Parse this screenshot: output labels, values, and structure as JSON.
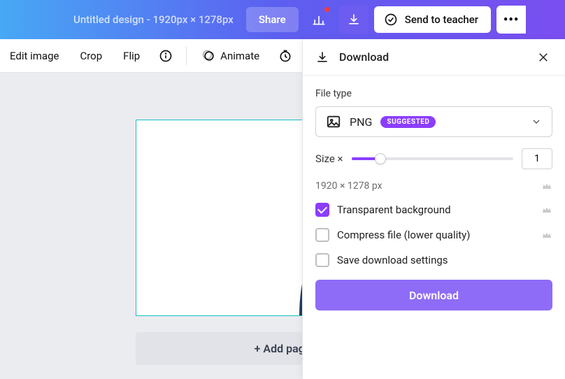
{
  "header": {
    "doc_title": "Untitled design - 1920px × 1278px",
    "share_label": "Share",
    "send_teacher_label": "Send to teacher"
  },
  "toolbar": {
    "edit_image": "Edit image",
    "crop": "Crop",
    "flip": "Flip",
    "animate": "Animate"
  },
  "canvas": {
    "add_page_label": "+ Add page"
  },
  "download": {
    "title": "Download",
    "filetype_label": "File type",
    "filetype_value": "PNG",
    "suggested_badge": "SUGGESTED",
    "size_label": "Size ×",
    "size_value": "1",
    "dimensions": "1920 × 1278 px",
    "transparent_bg_label": "Transparent background",
    "compress_label": "Compress file (lower quality)",
    "save_settings_label": "Save download settings",
    "download_button": "Download",
    "transparent_checked": true,
    "compress_checked": false,
    "save_checked": false
  }
}
